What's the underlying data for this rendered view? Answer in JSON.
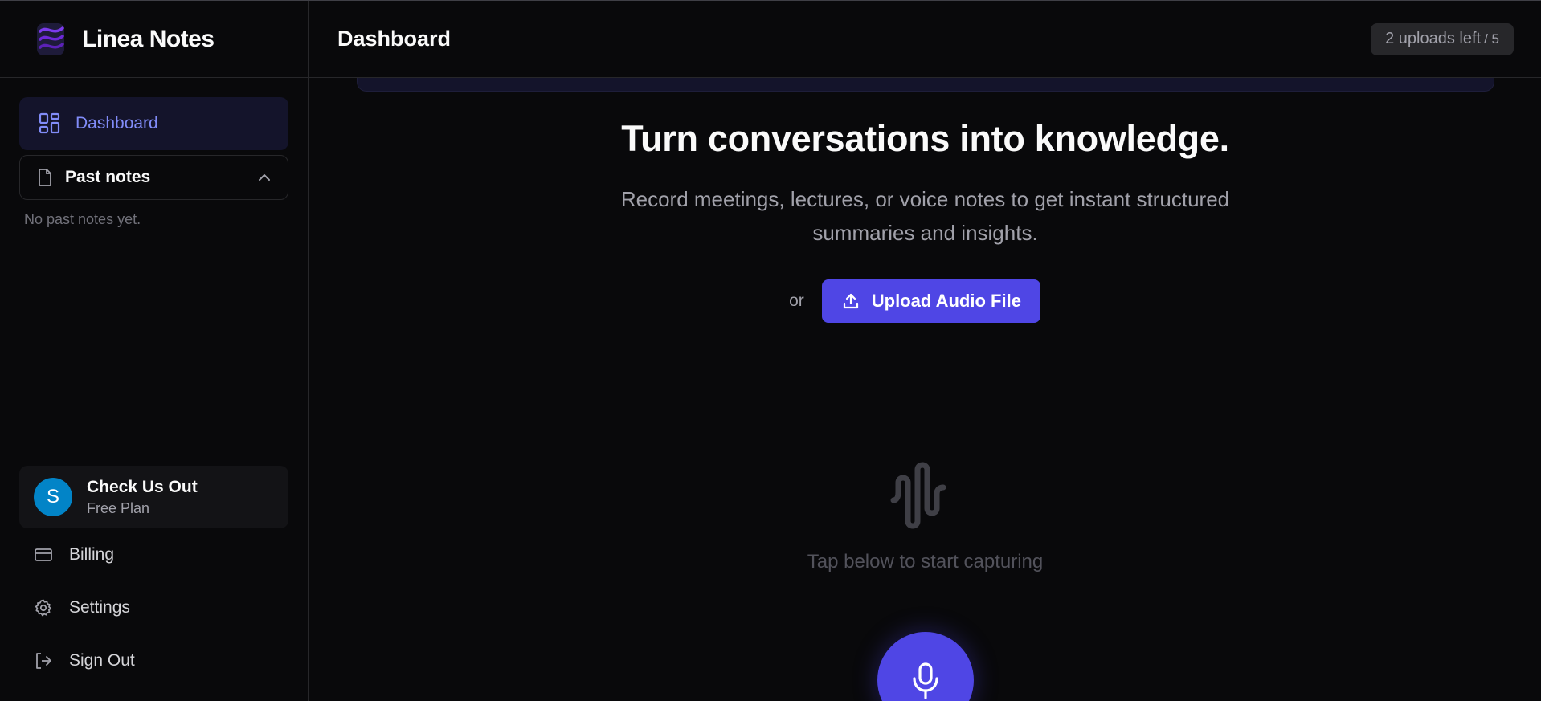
{
  "brand": {
    "name": "Linea Notes"
  },
  "sidebar": {
    "nav_active": "Dashboard",
    "past_notes_label": "Past notes",
    "empty_message": "No past notes yet.",
    "user": {
      "initial": "S",
      "name": "Check Us Out",
      "plan": "Free Plan"
    },
    "menu": [
      {
        "label": "Billing",
        "icon": "credit-card-icon"
      },
      {
        "label": "Settings",
        "icon": "gear-icon"
      },
      {
        "label": "Sign Out",
        "icon": "sign-out-icon"
      }
    ]
  },
  "header": {
    "title": "Dashboard",
    "uploads_left": "2 uploads left",
    "uploads_total": "/ 5"
  },
  "hero": {
    "heading": "Turn conversations into knowledge.",
    "subtext": "Record meetings, lectures, or voice notes to get instant structured summaries and insights."
  },
  "upload": {
    "or_label": "or",
    "button_label": "Upload Audio File"
  },
  "capture": {
    "hint": "Tap below to start capturing"
  },
  "colors": {
    "accent": "#4f46e5",
    "accent_text": "#818cf8",
    "avatar": "#0284c7",
    "background": "#09090b"
  }
}
